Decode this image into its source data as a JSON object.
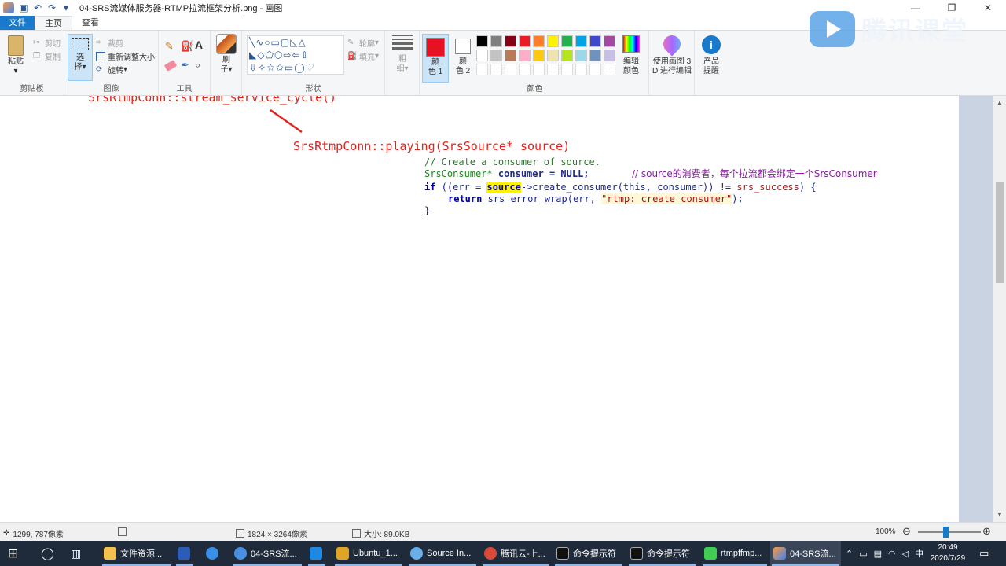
{
  "window": {
    "title": "04-SRS流媒体服务器-RTMP拉流框架分析.png - 画图",
    "controls": {
      "minimize": "—",
      "maximize": "❐",
      "close": "✕"
    }
  },
  "menu": {
    "file": "文件",
    "home": "主页",
    "view": "查看"
  },
  "ribbon": {
    "clipboard": {
      "paste": "粘贴",
      "cut": "剪切",
      "copy": "复制",
      "label": "剪贴板"
    },
    "image": {
      "select_1": "选",
      "select_2": "择",
      "crop": "裁剪",
      "resize": "重新调整大小",
      "rotate": "旋转",
      "label": "图像"
    },
    "tools": {
      "label": "工具",
      "text_tool": "A"
    },
    "brush": {
      "line1": "刷",
      "line2": "子"
    },
    "shapes": {
      "label": "形状",
      "outline": "轮廓",
      "fill": "填充"
    },
    "size": {
      "line1": "粗",
      "line2": "细"
    },
    "color1": {
      "line1": "颜",
      "line2": "色 1",
      "value": "#e81123"
    },
    "color2": {
      "line1": "颜",
      "line2": "色 2",
      "value": "#ffffff"
    },
    "colors_label": "颜色",
    "edit_colors": {
      "line1": "编辑",
      "line2": "颜色"
    },
    "paint3d": {
      "line1": "使用画图 3",
      "line2": "D 进行编辑"
    },
    "product_alert": {
      "line1": "产品",
      "line2": "提醒"
    }
  },
  "palette": [
    "#000000",
    "#7f7f7f",
    "#880015",
    "#ed1c24",
    "#ff7f27",
    "#fff200",
    "#22b14c",
    "#00a2e8",
    "#3f48cc",
    "#a349a4",
    "#ffffff",
    "#c3c3c3",
    "#b97a57",
    "#ffaec9",
    "#ffc90e",
    "#efe4b0",
    "#b5e61d",
    "#99d9ea",
    "#7092be",
    "#c8bfe7"
  ],
  "watermark": {
    "text": "腾讯课堂"
  },
  "canvas": {
    "partial_heading": "SrsRtmpConn::stream_service_cycle()",
    "heading": "SrsRtmpConn::playing(SrsSource* source)",
    "code": {
      "comment1": "// Create a consumer of source.",
      "type": "SrsConsumer*",
      "decl_rest": " consumer = NULL;",
      "comment2": "// source的消费者，每个拉流都会绑定一个SrsConsumer",
      "if_kw": "if",
      "if_a": " ((err = ",
      "if_hl": "source",
      "if_b": "->create_consumer(this, consumer)) != ",
      "if_red": "srs_success",
      "if_c": ") {",
      "ret_kw": "return",
      "ret_a": " srs_error_wrap(err, ",
      "ret_str": "\"rtmp: create consumer\"",
      "ret_b": ");",
      "close": "}"
    }
  },
  "status": {
    "cursor": "1299, 787像素",
    "dimensions": "1824 × 3264像素",
    "size": "大小: 89.0KB",
    "zoom": "100%"
  },
  "taskbar": {
    "items": [
      "文件资源...",
      "04-SRS流...",
      "Ubuntu_1...",
      "Source In...",
      "腾讯云-上...",
      "命令提示符",
      "命令提示符",
      "rtmpffmp...",
      "04-SRS流..."
    ],
    "time": "20:49",
    "date": "2020/7/29"
  }
}
